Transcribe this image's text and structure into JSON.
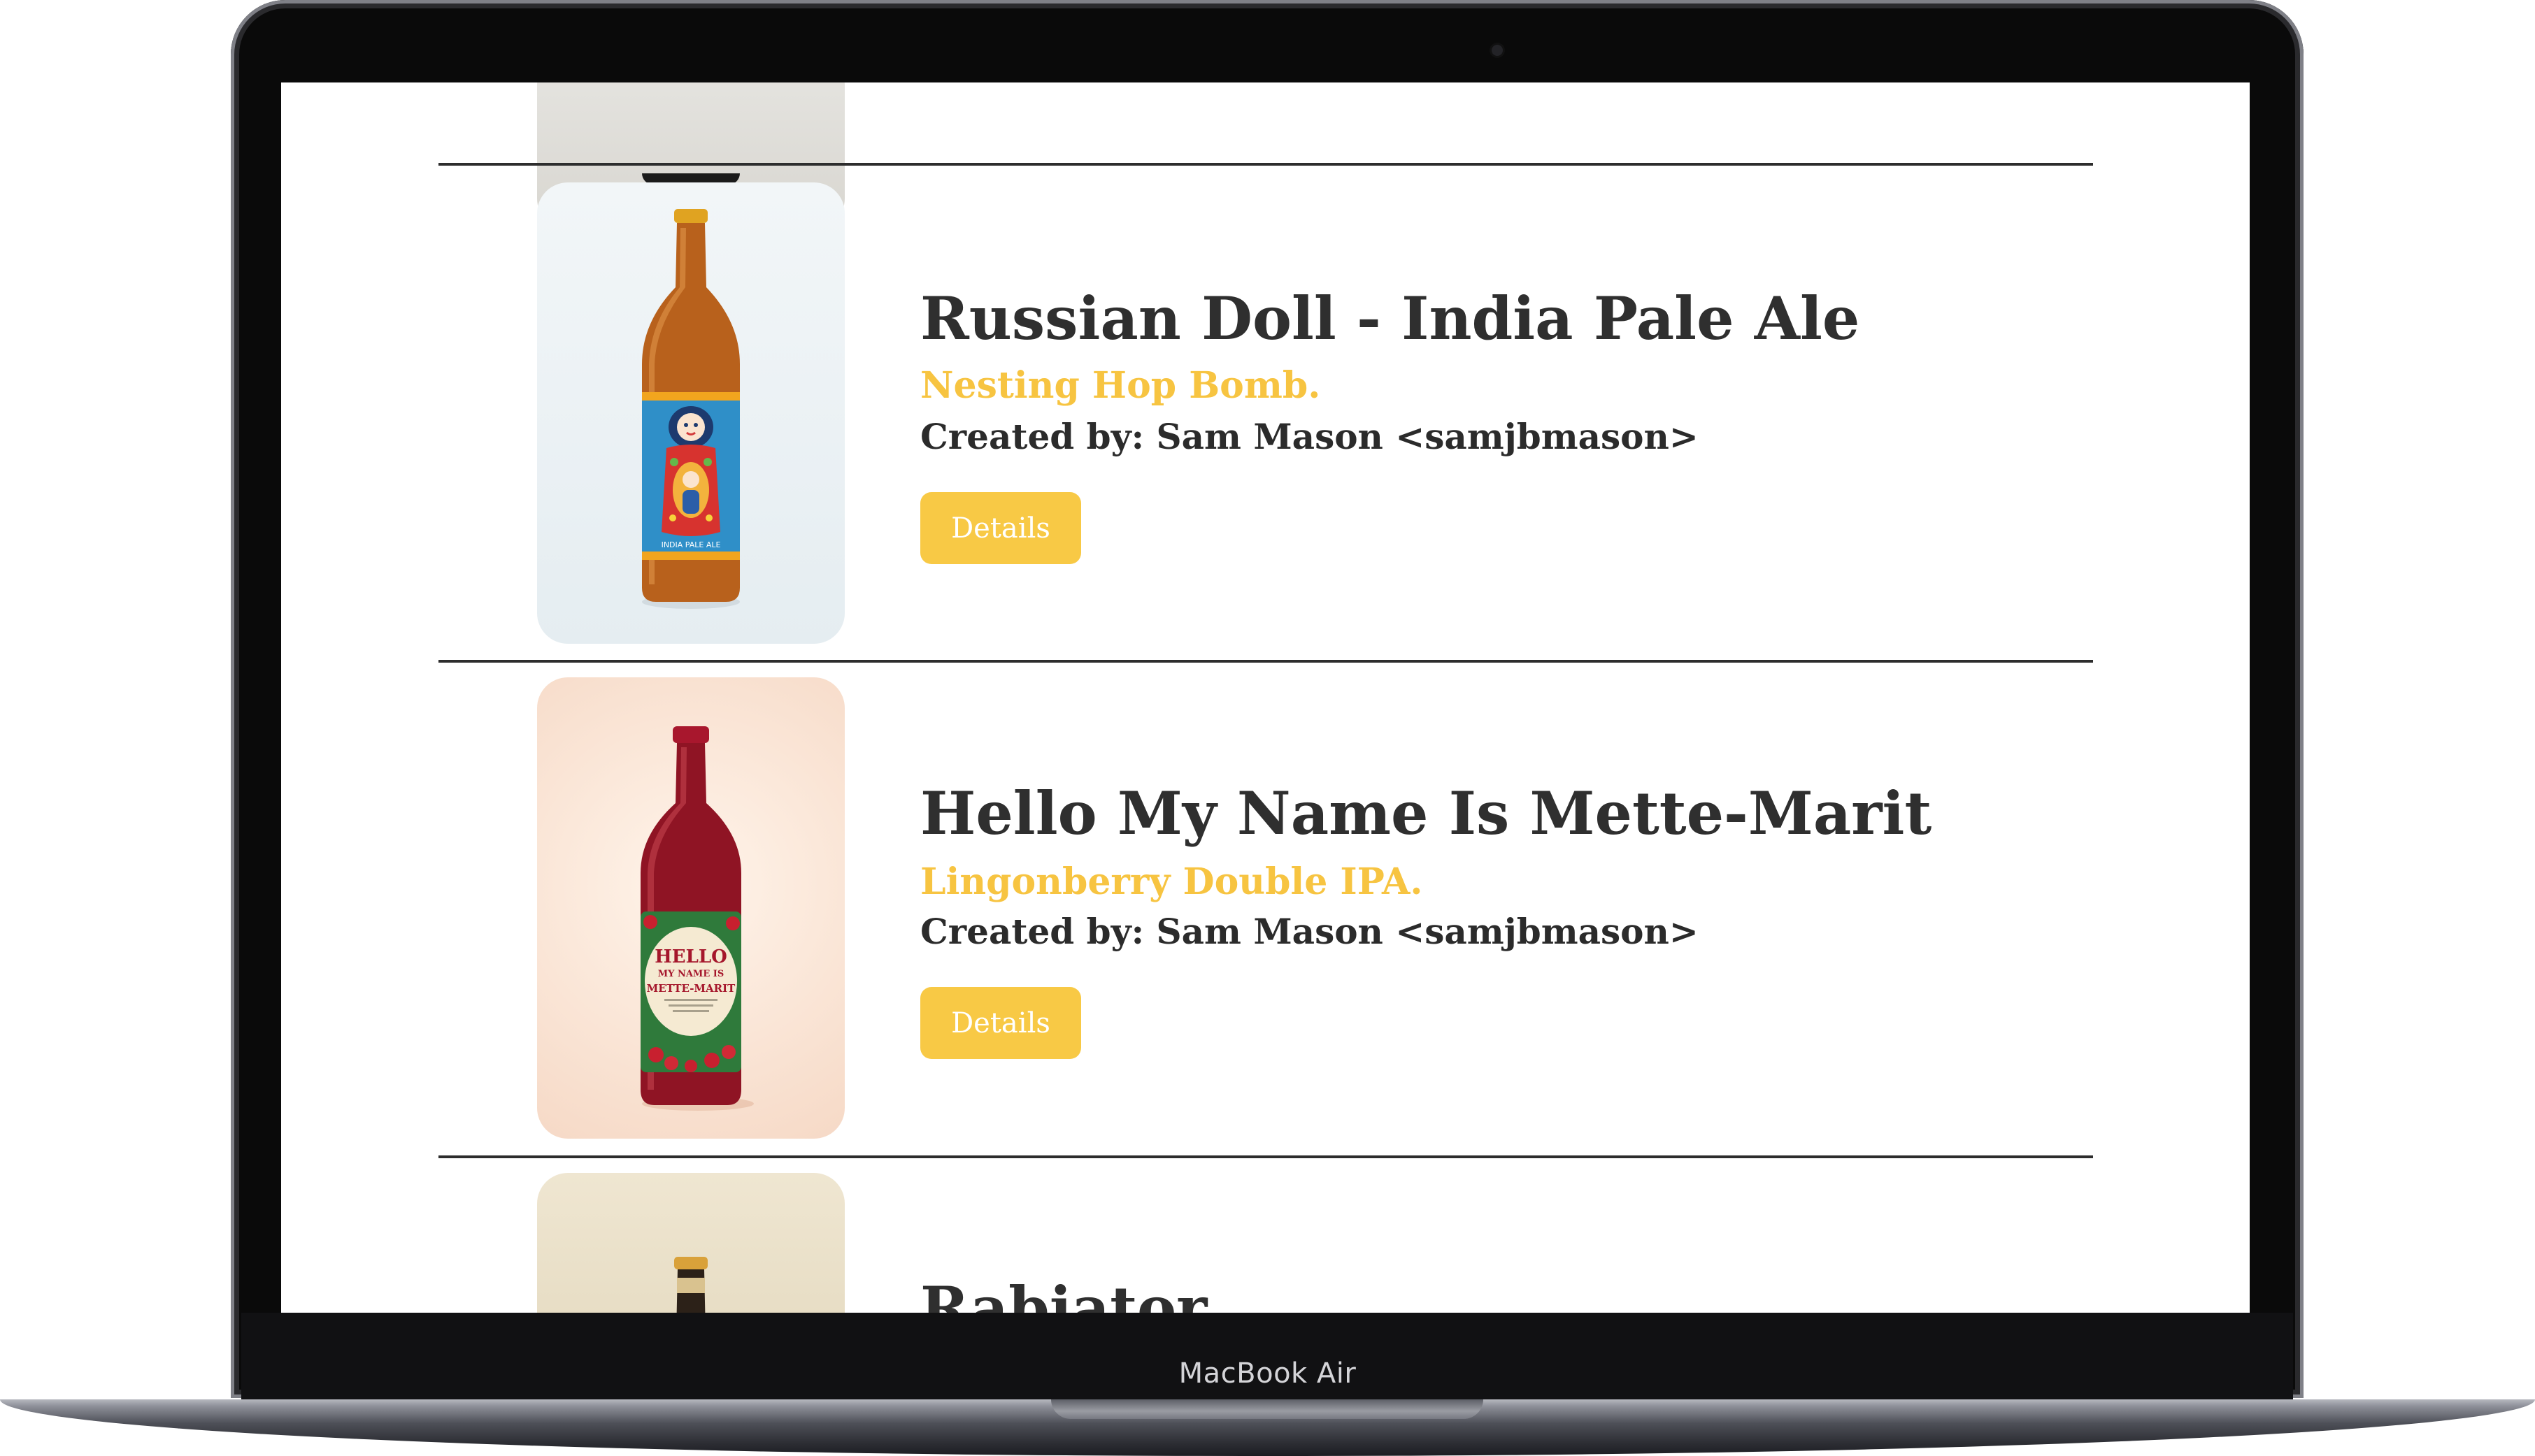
{
  "device": {
    "model_label": "MacBook Air"
  },
  "beers": [
    {
      "title": "Russian Doll - India Pale Ale",
      "tagline": "Nesting Hop Bomb.",
      "creator": "Created by: Sam Mason <samjbmason>",
      "details_label": "Details",
      "label_text": "INDIA PALE ALE"
    },
    {
      "title": "Hello My Name Is Mette-Marit",
      "tagline": "Lingonberry Double IPA.",
      "creator": "Created by: Sam Mason <samjbmason>",
      "details_label": "Details",
      "label_line1": "HELLO",
      "label_line2": "MY NAME IS",
      "label_line3": "METTE-MARIT"
    },
    {
      "title": "Rabiator"
    }
  ],
  "colors": {
    "accent": "#f8c945",
    "tagline": "#f7c441",
    "text": "#2f2f2f"
  }
}
